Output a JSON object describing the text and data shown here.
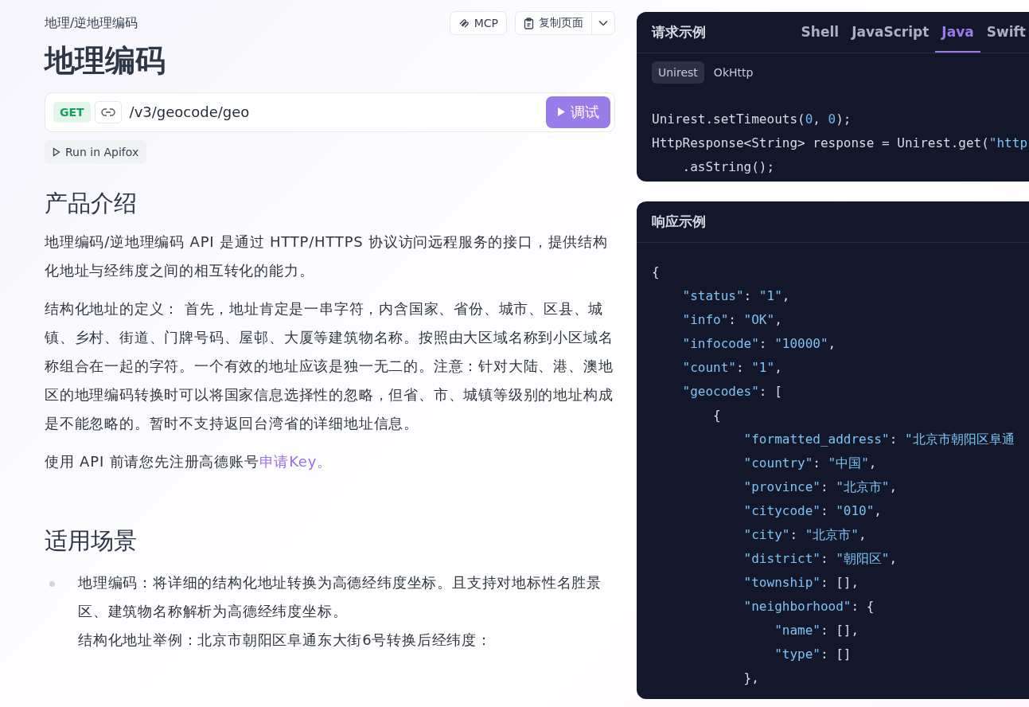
{
  "breadcrumb": "地理/逆地理编码",
  "header_buttons": [
    {
      "kind": "mcp",
      "label": "MCP"
    },
    {
      "kind": "copy",
      "label": "复制页面"
    }
  ],
  "title": "地理编码",
  "endpoint": {
    "method": "GET",
    "path": "/v3/geocode/geo",
    "debug_button": "调试"
  },
  "run_button": "Run in Apifox",
  "sections": [
    {
      "heading": "产品介绍",
      "paragraphs": [
        {
          "text": "地理编码/逆地理编码 API 是通过 HTTP/HTTPS 协议访问远程服务的接口，提供结构化地址与经纬度之间的相互转化的能力。"
        },
        {
          "text": "结构化地址的定义： 首先，地址肯定是一串字符，内含国家、省份、城市、区县、城镇、乡村、街道、门牌号码、屋邨、大厦等建筑物名称。按照由大区域名称到小区域名称组合在一起的字符。一个有效的地址应该是独一无二的。注意：针对大陆、港、澳地区的地理编码转换时可以将国家信息选择性的忽略，但省、市、城镇等级别的地址构成是不能忽略的。暂时不支持返回台湾省的详细地址信息。"
        },
        {
          "text": "使用 API 前请您先注册高德账号",
          "link": "申请Key。"
        }
      ]
    },
    {
      "heading": "适用场景",
      "bullets": [
        {
          "lines": [
            "地理编码：将详细的结构化地址转换为高德经纬度坐标。且支持对地标性名胜景区、建筑物名称解析为高德经纬度坐标。",
            "结构化地址举例：北京市朝阳区阜通东大街6号转换后经纬度："
          ]
        }
      ]
    }
  ],
  "request_example": {
    "title": "请求示例",
    "tabs": [
      {
        "label": "Shell",
        "selected": false
      },
      {
        "label": "JavaScript",
        "selected": false
      },
      {
        "label": "Java",
        "selected": true
      },
      {
        "label": "Swift",
        "selected": false
      }
    ],
    "libraries": [
      {
        "label": "Unirest",
        "selected": true
      },
      {
        "label": "OkHttp",
        "selected": false
      }
    ],
    "code": [
      [
        {
          "kind": "plain",
          "text": "Unirest.setTimeouts("
        },
        {
          "kind": "number",
          "text": "0"
        },
        {
          "kind": "plain",
          "text": ", "
        },
        {
          "kind": "number",
          "text": "0"
        },
        {
          "kind": "plain",
          "text": ");"
        }
      ],
      [
        {
          "kind": "plain",
          "text": "HttpResponse<String> response = Unirest.get("
        },
        {
          "kind": "string",
          "text": "\"http"
        }
      ],
      [
        {
          "kind": "plain",
          "text": "    .asString();"
        }
      ]
    ]
  },
  "response_example": {
    "title": "响应示例",
    "code": [
      [
        {
          "kind": "plain",
          "text": "{"
        }
      ],
      [
        {
          "kind": "string",
          "text": "    \"status\""
        },
        {
          "kind": "plain",
          "text": ": "
        },
        {
          "kind": "string",
          "text": "\"1\""
        },
        {
          "kind": "plain",
          "text": ","
        }
      ],
      [
        {
          "kind": "string",
          "text": "    \"info\""
        },
        {
          "kind": "plain",
          "text": ": "
        },
        {
          "kind": "string",
          "text": "\"OK\""
        },
        {
          "kind": "plain",
          "text": ","
        }
      ],
      [
        {
          "kind": "string",
          "text": "    \"infocode\""
        },
        {
          "kind": "plain",
          "text": ": "
        },
        {
          "kind": "string",
          "text": "\"10000\""
        },
        {
          "kind": "plain",
          "text": ","
        }
      ],
      [
        {
          "kind": "string",
          "text": "    \"count\""
        },
        {
          "kind": "plain",
          "text": ": "
        },
        {
          "kind": "string",
          "text": "\"1\""
        },
        {
          "kind": "plain",
          "text": ","
        }
      ],
      [
        {
          "kind": "string",
          "text": "    \"geocodes\""
        },
        {
          "kind": "plain",
          "text": ": ["
        }
      ],
      [
        {
          "kind": "plain",
          "text": "        {"
        }
      ],
      [
        {
          "kind": "string",
          "text": "            \"formatted_address\""
        },
        {
          "kind": "plain",
          "text": ": "
        },
        {
          "kind": "string",
          "text": "\"北京市朝阳区阜通"
        }
      ],
      [
        {
          "kind": "string",
          "text": "            \"country\""
        },
        {
          "kind": "plain",
          "text": ": "
        },
        {
          "kind": "string",
          "text": "\"中国\""
        },
        {
          "kind": "plain",
          "text": ","
        }
      ],
      [
        {
          "kind": "string",
          "text": "            \"province\""
        },
        {
          "kind": "plain",
          "text": ": "
        },
        {
          "kind": "string",
          "text": "\"北京市\""
        },
        {
          "kind": "plain",
          "text": ","
        }
      ],
      [
        {
          "kind": "string",
          "text": "            \"citycode\""
        },
        {
          "kind": "plain",
          "text": ": "
        },
        {
          "kind": "string",
          "text": "\"010\""
        },
        {
          "kind": "plain",
          "text": ","
        }
      ],
      [
        {
          "kind": "string",
          "text": "            \"city\""
        },
        {
          "kind": "plain",
          "text": ": "
        },
        {
          "kind": "string",
          "text": "\"北京市\""
        },
        {
          "kind": "plain",
          "text": ","
        }
      ],
      [
        {
          "kind": "string",
          "text": "            \"district\""
        },
        {
          "kind": "plain",
          "text": ": "
        },
        {
          "kind": "string",
          "text": "\"朝阳区\""
        },
        {
          "kind": "plain",
          "text": ","
        }
      ],
      [
        {
          "kind": "string",
          "text": "            \"township\""
        },
        {
          "kind": "plain",
          "text": ": [],"
        }
      ],
      [
        {
          "kind": "string",
          "text": "            \"neighborhood\""
        },
        {
          "kind": "plain",
          "text": ": {"
        }
      ],
      [
        {
          "kind": "string",
          "text": "                \"name\""
        },
        {
          "kind": "plain",
          "text": ": [],"
        }
      ],
      [
        {
          "kind": "string",
          "text": "                \"type\""
        },
        {
          "kind": "plain",
          "text": ": []"
        }
      ],
      [
        {
          "kind": "plain",
          "text": "            },"
        }
      ]
    ]
  }
}
